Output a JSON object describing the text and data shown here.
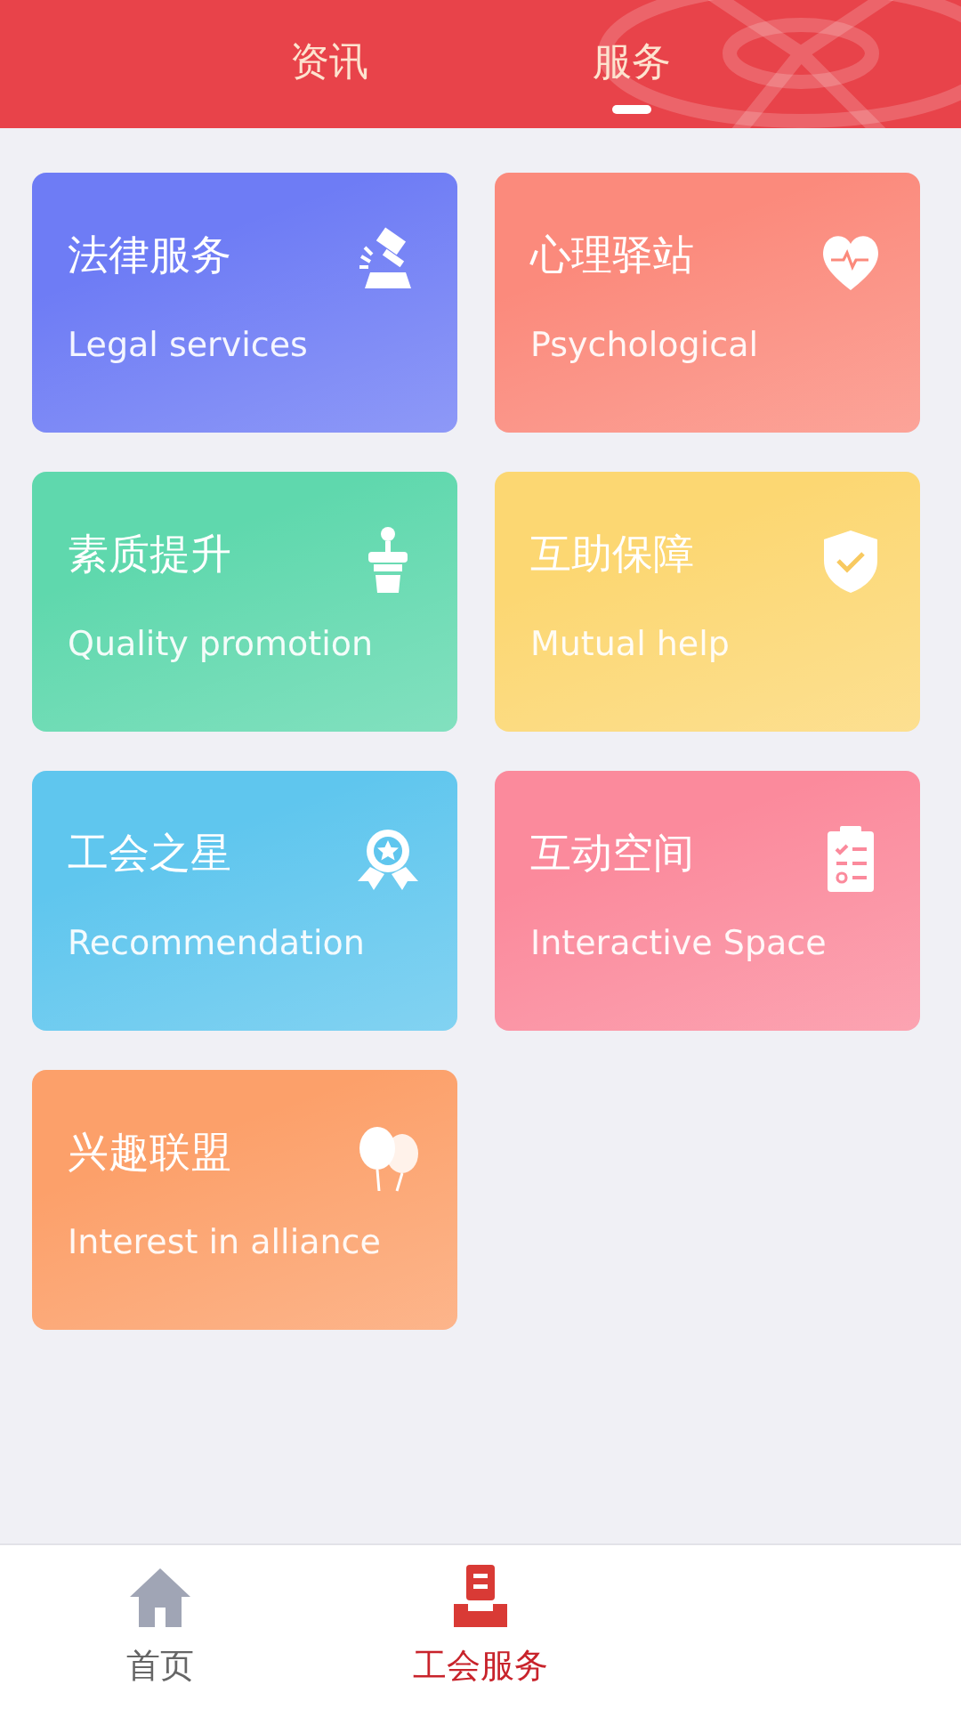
{
  "top_tabs": [
    {
      "label": "资讯",
      "selected": false
    },
    {
      "label": "服务",
      "selected": true
    }
  ],
  "cards": [
    {
      "title": "法律服务",
      "subtitle": "Legal services",
      "kind": "gavel",
      "color": "#6e7cf5"
    },
    {
      "title": "心理驿站",
      "subtitle": "Psychological",
      "kind": "heart",
      "color": "#fb8a7c"
    },
    {
      "title": "素质提升",
      "subtitle": "Quality promotion",
      "kind": "podium",
      "color": "#5fd8ad"
    },
    {
      "title": "互助保障",
      "subtitle": "Mutual help",
      "kind": "shield",
      "color": "#fcd772"
    },
    {
      "title": "工会之星",
      "subtitle": "Recommendation",
      "kind": "award",
      "color": "#5fc6ee"
    },
    {
      "title": "互动空间",
      "subtitle": "Interactive Space",
      "kind": "clipboard",
      "color": "#fb8a9c"
    },
    {
      "title": "兴趣联盟",
      "subtitle": "Interest in alliance",
      "kind": "balloons",
      "color": "#fca06a"
    }
  ],
  "bottom_nav": [
    {
      "label": "首页",
      "kind": "home",
      "selected": false
    },
    {
      "label": "工会服务",
      "kind": "service",
      "selected": true
    }
  ]
}
